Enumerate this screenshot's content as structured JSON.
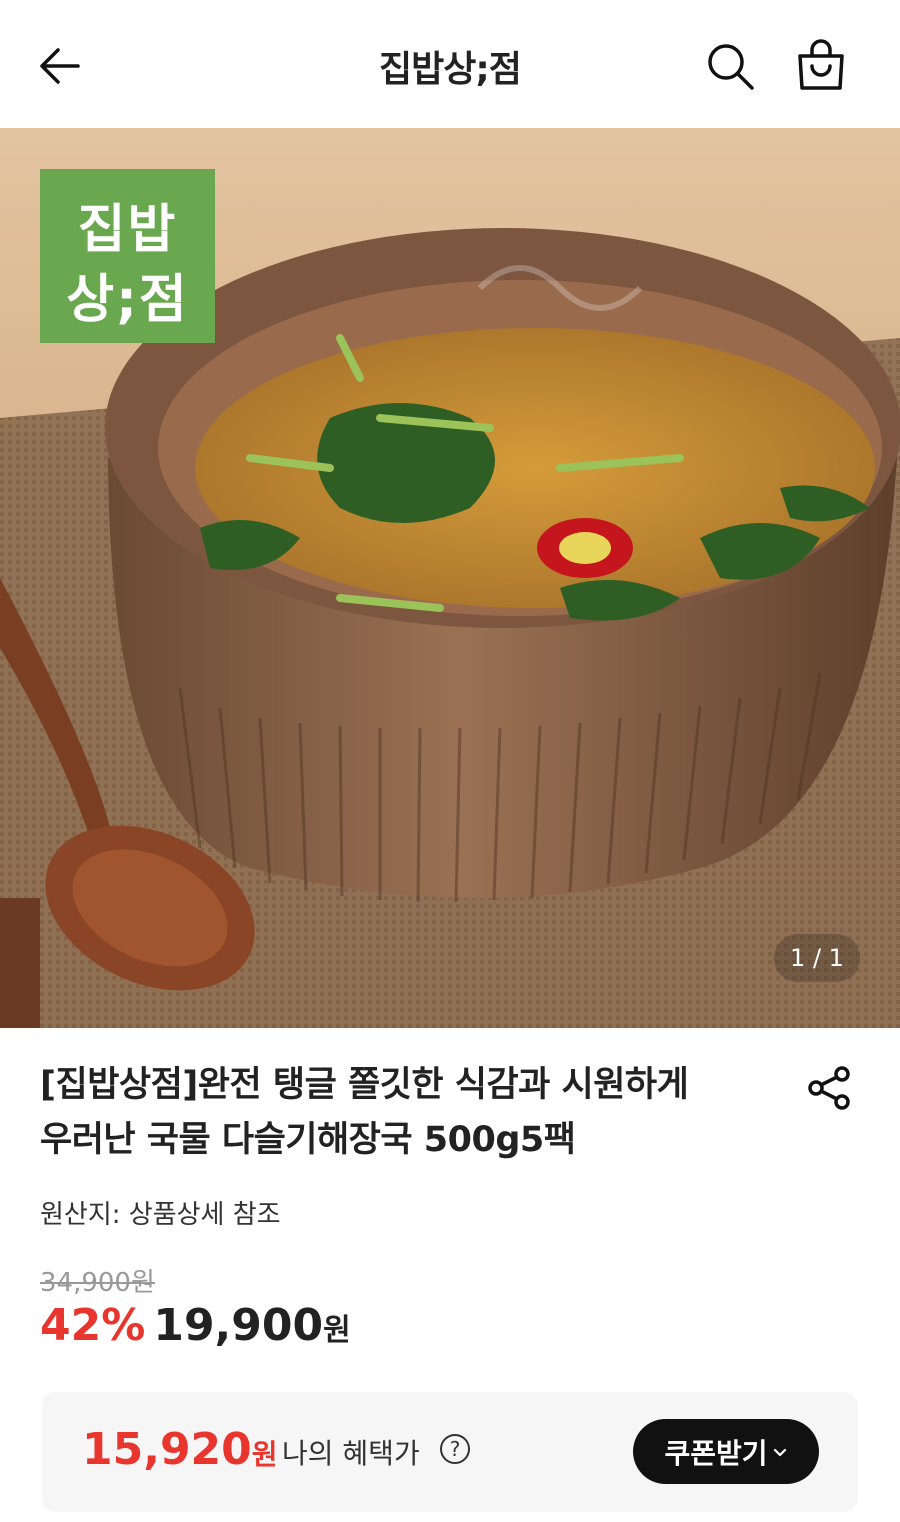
{
  "header": {
    "title": "집밥상;점",
    "back_icon": "arrow-left-icon",
    "search_icon": "search-icon",
    "cart_icon": "shopping-bag-icon"
  },
  "hero": {
    "badge_line1": "집밥",
    "badge_line2": "상;점",
    "pager": "1 / 1",
    "badge_color": "#6aa84f"
  },
  "product": {
    "title_line1": "[집밥상점]완전 탱글 쫄깃한 식감과 시원하게",
    "title_line2": "우러난 국물 다슬기해장국 500g5팩",
    "share_icon": "share-icon",
    "origin": "원산지: 상품상세 참조",
    "original_price": "34,900원",
    "discount": "42%",
    "sale_price": "19,900",
    "sale_unit": "원"
  },
  "benefit": {
    "price": "15,920",
    "unit": "원",
    "label": "나의 혜택가",
    "help_icon": "?",
    "coupon_button": "쿠폰받기",
    "accent_color": "#e8362e"
  }
}
